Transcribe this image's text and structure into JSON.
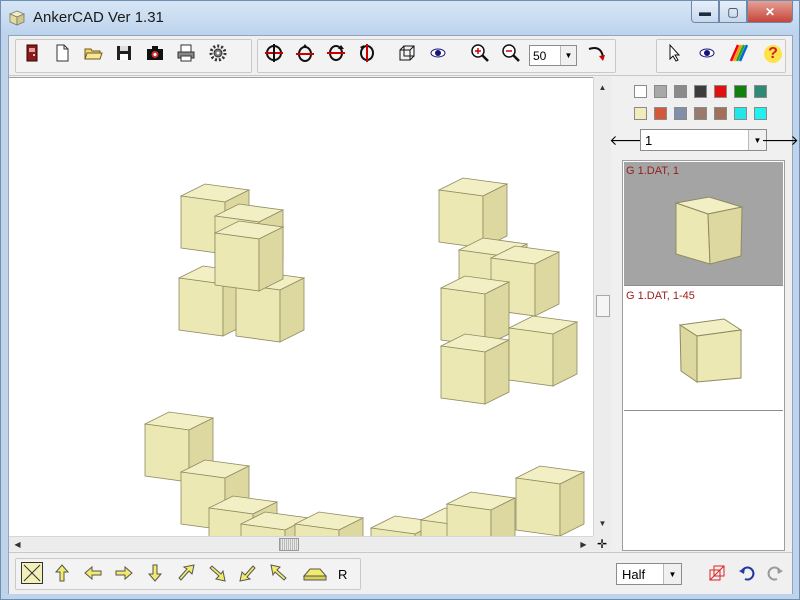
{
  "window": {
    "title": "AnkerCAD Ver 1.31",
    "icon": "cube-icon",
    "controls": [
      "minimize",
      "maximize",
      "close"
    ]
  },
  "toolbar": {
    "file_tools": [
      {
        "icon": "exit-door-icon",
        "name": "exit"
      },
      {
        "icon": "new-file-icon",
        "name": "new"
      },
      {
        "icon": "open-folder-icon",
        "name": "open"
      },
      {
        "icon": "save-disk-icon",
        "name": "save"
      },
      {
        "icon": "camera-icon",
        "name": "screenshot"
      },
      {
        "icon": "printer-icon",
        "name": "print"
      },
      {
        "icon": "gear-icon",
        "name": "settings"
      }
    ],
    "view_tools": [
      {
        "icon": "rotate-left-icon"
      },
      {
        "icon": "rotate-right-icon"
      },
      {
        "icon": "rotate-up-icon"
      },
      {
        "icon": "rotate-down-icon"
      },
      {
        "icon": "wireframe-cube-icon"
      },
      {
        "icon": "eye-icon"
      },
      {
        "icon": "zoom-in-icon"
      },
      {
        "icon": "zoom-out-icon"
      }
    ],
    "zoom_value": "50",
    "reset_icon": "curve-arrow-icon",
    "mode_tools": [
      {
        "icon": "pointer-icon"
      },
      {
        "icon": "eye-icon"
      },
      {
        "icon": "rainbow-icon"
      },
      {
        "icon": "help-icon",
        "label": "?"
      }
    ]
  },
  "palette": {
    "colors": [
      "#ffffff",
      "#a8a8a8",
      "#8a8a8a",
      "#3c3c3c",
      "#e01010",
      "#108010",
      "#2e8a74",
      "#f0ecbc",
      "#d25a3a",
      "#8090a8",
      "#9a7a6a",
      "#a07058",
      "#20e8e8",
      "#20f0f0"
    ]
  },
  "part_selector": {
    "value": "1",
    "prev_icon": "arrow-left-icon",
    "next_icon": "arrow-right-icon"
  },
  "parts": [
    {
      "label": "G 1.DAT, 1",
      "selected": true
    },
    {
      "label": "G 1.DAT, 1-45",
      "selected": false
    }
  ],
  "bottom_tools": {
    "tools": [
      {
        "icon": "select-box-icon"
      },
      {
        "icon": "arrow-up-icon"
      },
      {
        "icon": "arrow-left-icon"
      },
      {
        "icon": "arrow-right-icon"
      },
      {
        "icon": "arrow-down-icon"
      },
      {
        "icon": "arrow-up-right-icon"
      },
      {
        "icon": "arrow-down-right-icon"
      },
      {
        "icon": "arrow-down-left-icon"
      },
      {
        "icon": "arrow-up-left-icon"
      },
      {
        "icon": "flat-plate-icon"
      }
    ],
    "r_label": "R",
    "quality": "Half",
    "extra_icons": [
      "cube-select-icon",
      "undo-icon",
      "redo-icon"
    ]
  },
  "scene": {
    "block_color": "#ece8b4",
    "block_top": "#f2efc4",
    "block_side": "#ddd8a0",
    "edge_color": "#8f8b60"
  }
}
